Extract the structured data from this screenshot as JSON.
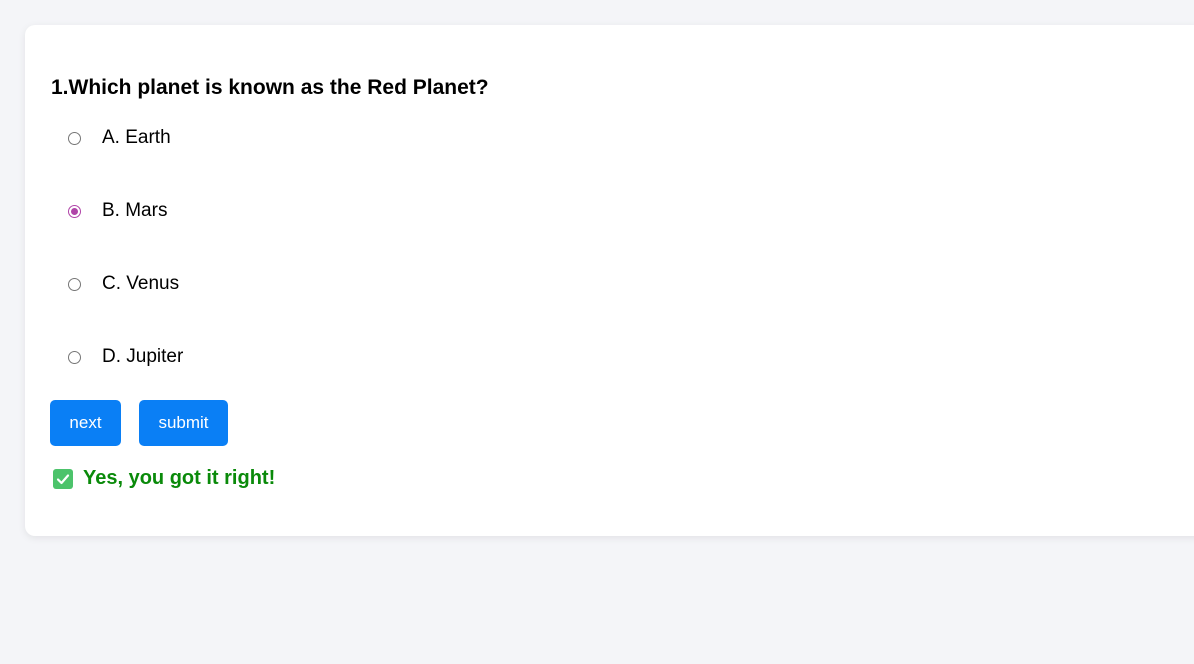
{
  "quiz": {
    "question": "1.Which planet is known as the Red Planet?",
    "options": [
      {
        "label": "A. Earth",
        "selected": false
      },
      {
        "label": "B. Mars",
        "selected": true
      },
      {
        "label": "C. Venus",
        "selected": false
      },
      {
        "label": "D. Jupiter",
        "selected": false
      }
    ],
    "accent_color": "#b044a8"
  },
  "buttons": {
    "next_label": "next",
    "submit_label": "submit",
    "color": "#0a7ff5"
  },
  "feedback": {
    "icon": "check-mark-icon",
    "text": "Yes, you got it right!",
    "color": "#0a8a0a"
  }
}
